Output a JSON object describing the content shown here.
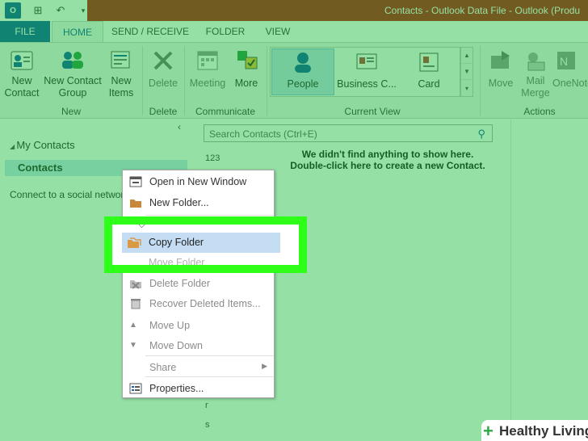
{
  "window": {
    "title": "Contacts - Outlook Data File - Outlook (Produ"
  },
  "tabs": [
    "FILE",
    "HOME",
    "SEND / RECEIVE",
    "FOLDER",
    "VIEW"
  ],
  "ribbon": {
    "new_group": {
      "label": "New",
      "new_contact": "New Contact",
      "new_contact_group": "New Contact Group",
      "new_items": "New Items"
    },
    "delete_group": {
      "label": "Delete",
      "delete": "Delete"
    },
    "communicate_group": {
      "label": "Communicate",
      "meeting": "Meeting",
      "more": "More"
    },
    "current_view_group": {
      "label": "Current View",
      "people": "People",
      "business_card": "Business C...",
      "card": "Card"
    },
    "actions_group": {
      "label": "Actions",
      "move": "Move",
      "mail_merge": "Mail Merge",
      "onenote": "OneNote"
    }
  },
  "nav": {
    "my_contacts": "My Contacts",
    "contacts": "Contacts",
    "social": "Connect to a social network"
  },
  "list": {
    "search_placeholder": "Search Contacts (Ctrl+E)",
    "empty_line1": "We didn't find anything to show here.",
    "empty_line2": "Double-click here to create a new Contact.",
    "letters": [
      "123",
      "r",
      "s"
    ]
  },
  "context_menu": {
    "open_new_window": "Open in New Window",
    "new_folder": "New Folder...",
    "copy_folder": "Copy Folder",
    "move_folder": "Move Folder",
    "delete_folder": "Delete Folder",
    "recover_deleted": "Recover Deleted Items...",
    "move_up": "Move Up",
    "move_down": "Move Down",
    "share": "Share",
    "properties": "Properties..."
  },
  "watermark": {
    "brand": "Healthy Living"
  },
  "colors": {
    "accent": "#1e5fa8",
    "titlebar": "#c41b1b",
    "highlight_border": "#2dff19",
    "overlay": "#00b428"
  }
}
